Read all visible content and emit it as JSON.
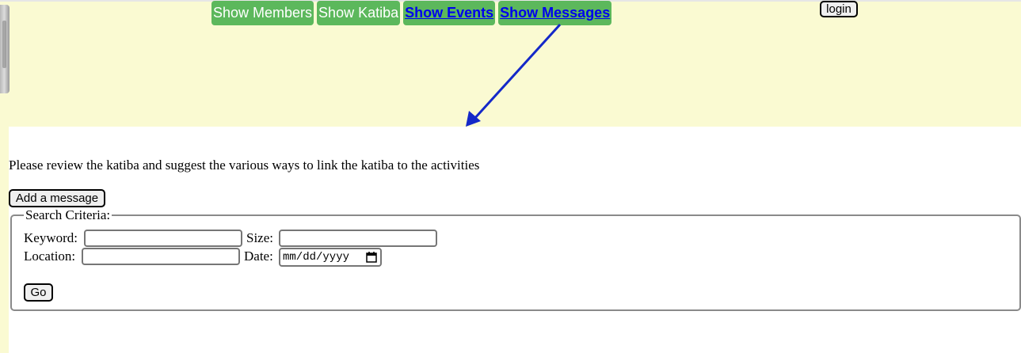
{
  "nav": {
    "show_members": "Show Members",
    "show_katiba": "Show Katiba",
    "show_events": "Show Events",
    "show_messages": "Show Messages"
  },
  "login_label": "login",
  "message_text": "Please review the katiba and suggest the various ways to link the katiba to the activities",
  "add_message_label": "Add a message",
  "search": {
    "legend": "Search Criteria:",
    "keyword_label": "Keyword:",
    "keyword_value": "",
    "size_label": "Size:",
    "size_value": "",
    "location_label": "Location:",
    "location_value": "",
    "date_label": "Date:",
    "date_placeholder": "mm/dd/yyyy",
    "go_label": "Go"
  },
  "colors": {
    "page_background": "#fafad2",
    "nav_button": "#5cb85c",
    "link": "#0000ee",
    "annotation_arrow": "#1428c8"
  },
  "icons": {
    "calendar": "calendar-icon",
    "annotation": "arrow-annotation"
  }
}
